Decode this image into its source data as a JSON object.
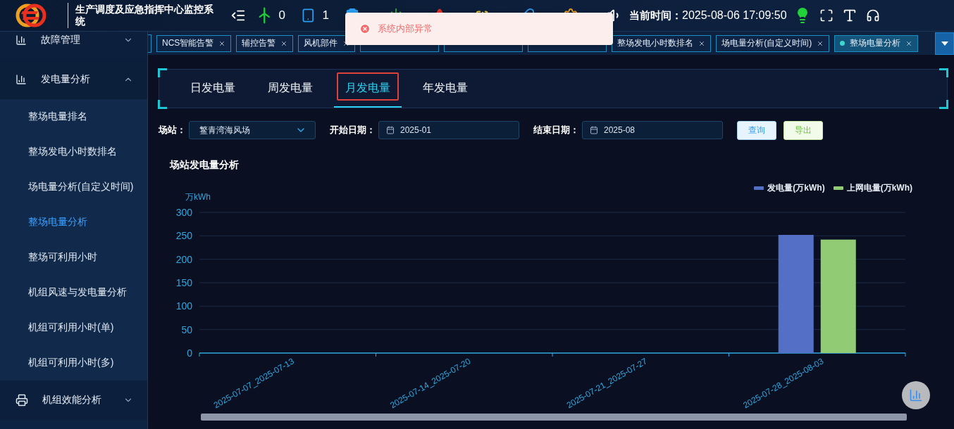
{
  "header": {
    "title": "生产调度及应急指挥中心监控系统",
    "stats": [
      {
        "kind": "turbine",
        "count": "0"
      },
      {
        "kind": "device",
        "count": "1"
      },
      {
        "kind": "clipboard"
      },
      {
        "kind": "power"
      },
      {
        "kind": "alert"
      },
      {
        "kind": "battery"
      },
      {
        "kind": "pill"
      },
      {
        "kind": "gear"
      }
    ],
    "time_label": "当前时间：",
    "time": "2025-08-06 17:09:50"
  },
  "toast": {
    "message": "系统内部异常"
  },
  "sidebar": {
    "groups": [
      {
        "kind": "chart",
        "label": "故障管理",
        "expanded": false
      },
      {
        "kind": "chart",
        "label": "发电量分析",
        "expanded": true,
        "children": [
          {
            "label": "整场电量排名",
            "selected": false
          },
          {
            "label": "整场发电小时数排名",
            "selected": false
          },
          {
            "label": "场电量分析(自定义时间)",
            "selected": false
          },
          {
            "label": "整场电量分析",
            "selected": true
          },
          {
            "label": "整场可利用小时",
            "selected": false
          },
          {
            "label": "机组风速与发电量分析",
            "selected": false
          },
          {
            "label": "机组可利用小时(单)",
            "selected": false
          },
          {
            "label": "机组可利用小时(多)",
            "selected": false
          }
        ]
      },
      {
        "kind": "printer",
        "label": "机组效能分析",
        "expanded": false
      }
    ]
  },
  "open_tabs": [
    {
      "label": "NCS智能告警",
      "selected": false
    },
    {
      "label": "辅控告警",
      "selected": false
    },
    {
      "label": "风机部件",
      "selected": false
    },
    {
      "selected": false
    },
    {
      "selected": false
    },
    {
      "selected": false
    },
    {
      "label": "整场发电小时数排名",
      "selected": false
    },
    {
      "label": "场电量分析(自定义时间)",
      "selected": false
    },
    {
      "label": "整场电量分析",
      "selected": true
    }
  ],
  "period_tabs": [
    {
      "label": "日发电量",
      "selected": false
    },
    {
      "label": "周发电量",
      "selected": false
    },
    {
      "label": "月发电量",
      "selected": true
    },
    {
      "label": "年发电量",
      "selected": false
    }
  ],
  "filters": {
    "station_label": "场站：",
    "station": "鳘青湾海风场",
    "start_label": "开始日期：",
    "start": "2025-01",
    "end_label": "结束日期：",
    "end": "2025-08",
    "query_button": "查询",
    "export_button": "导出"
  },
  "chart_data": {
    "type": "bar",
    "title": "场站发电量分析",
    "ylabel": "万kWh",
    "grid": true,
    "legend": true,
    "categories": [
      "2025-07-07_2025-07-13",
      "2025-07-14_2025-07-20",
      "2025-07-21_2025-07-27",
      "2025-07-28_2025-08-03"
    ],
    "series": [
      {
        "name": "发电量(万kWh)",
        "color": "#5470c6",
        "values": [
          0,
          0,
          0,
          252
        ]
      },
      {
        "name": "上网电量(万kWh)",
        "color": "#91cc75",
        "values": [
          0,
          0,
          0,
          242
        ]
      }
    ],
    "ylim": [
      0,
      300
    ],
    "yticks": [
      0,
      50,
      100,
      150,
      200,
      250,
      300
    ]
  }
}
